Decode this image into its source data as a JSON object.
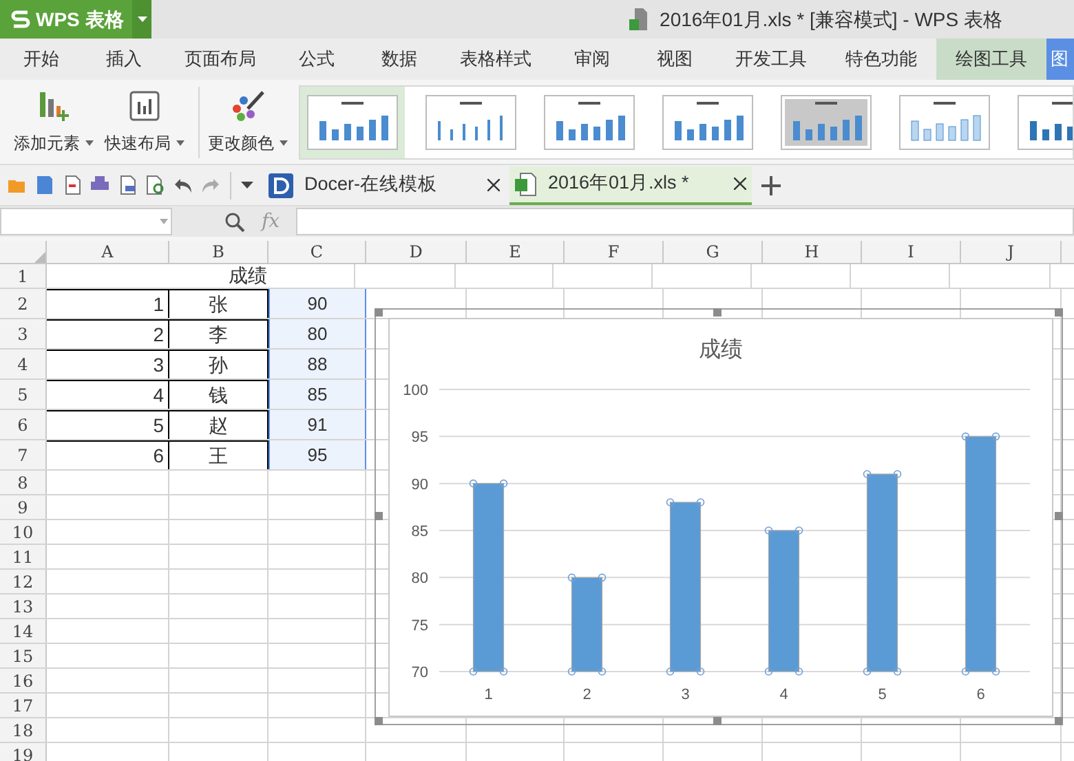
{
  "app_button": {
    "label": "WPS 表格"
  },
  "window": {
    "title": "2016年01月.xls * [兼容模式] - WPS 表格"
  },
  "menu_tabs": [
    {
      "label": "开始",
      "kind": "normal",
      "selected": false
    },
    {
      "label": "插入",
      "kind": "normal",
      "selected": false
    },
    {
      "label": "页面布局",
      "kind": "normal",
      "selected": false
    },
    {
      "label": "公式",
      "kind": "normal",
      "selected": false
    },
    {
      "label": "数据",
      "kind": "normal",
      "selected": false
    },
    {
      "label": "表格样式",
      "kind": "normal",
      "selected": false
    },
    {
      "label": "审阅",
      "kind": "normal",
      "selected": false
    },
    {
      "label": "视图",
      "kind": "normal",
      "selected": false
    },
    {
      "label": "开发工具",
      "kind": "normal",
      "selected": false
    },
    {
      "label": "特色功能",
      "kind": "normal",
      "selected": false
    },
    {
      "label": "绘图工具",
      "kind": "context",
      "selected": false
    },
    {
      "label": "图",
      "kind": "context",
      "selected": true
    }
  ],
  "ribbon": {
    "buttons": [
      {
        "label": "添加元素",
        "kind": "add"
      },
      {
        "label": "快速布局",
        "kind": "layout"
      },
      {
        "label": "更改颜色",
        "kind": "color"
      }
    ],
    "chart_styles": [
      {
        "selected": true
      },
      {
        "selected": false
      },
      {
        "selected": false
      },
      {
        "selected": false
      },
      {
        "selected": false
      },
      {
        "selected": false
      },
      {
        "selected": false
      }
    ]
  },
  "doc_tabs": [
    {
      "label": "Docer-在线模板",
      "selected": false
    },
    {
      "label": "2016年01月.xls *",
      "selected": true
    }
  ],
  "formula_bar": {
    "fx": "fx"
  },
  "sheet": {
    "columns": [
      "A",
      "B",
      "C",
      "D",
      "E",
      "F",
      "G",
      "H",
      "I",
      "J"
    ],
    "row_numbers": [
      "1",
      "2",
      "3",
      "4",
      "5",
      "6",
      "7",
      "8",
      "9",
      "10",
      "11",
      "12",
      "13",
      "14",
      "15",
      "16",
      "17",
      "18",
      "19"
    ],
    "title_cell": "成绩",
    "rows": [
      {
        "a": "1",
        "b": "张",
        "c": "90",
        "c_selected": true
      },
      {
        "a": "2",
        "b": "李",
        "c": "80",
        "c_selected": true
      },
      {
        "a": "3",
        "b": "孙",
        "c": "88",
        "c_selected": true
      },
      {
        "a": "4",
        "b": "钱",
        "c": "85",
        "c_selected": true
      },
      {
        "a": "5",
        "b": "赵",
        "c": "91",
        "c_selected": true
      },
      {
        "a": "6",
        "b": "王",
        "c": "95",
        "c_selected": true
      }
    ]
  },
  "chart": {
    "selected": true,
    "chart_data": {
      "type": "bar",
      "title": "成绩",
      "categories": [
        "1",
        "2",
        "3",
        "4",
        "5",
        "6"
      ],
      "series": [
        {
          "color": "#5b9bd5",
          "values": [
            90,
            80,
            88,
            85,
            91,
            95
          ]
        }
      ],
      "grid": true,
      "ylim": [
        70,
        100
      ],
      "yticks": [
        70,
        75,
        80,
        85,
        90,
        95,
        100
      ]
    }
  }
}
